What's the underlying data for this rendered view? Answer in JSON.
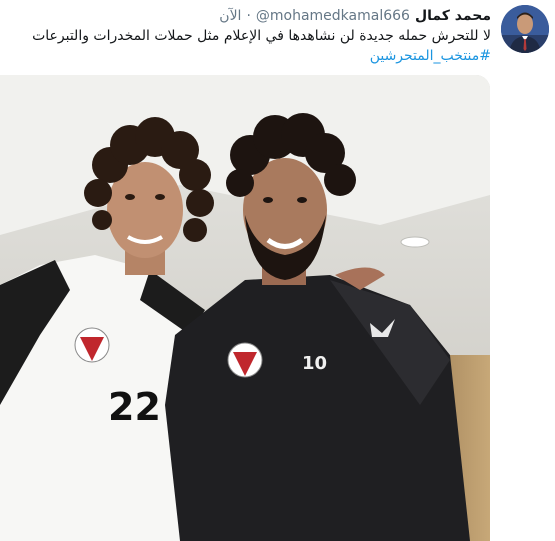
{
  "tweet": {
    "author": {
      "display_name": "محمد كمال",
      "handle": "@mohamedkamal666",
      "avatar_icon": "user-avatar-icon"
    },
    "separator": "·",
    "timestamp": "الآن",
    "text_line_1": "لا للتحرش حمله جديدة لن نشاهدها في الإعلام مثل حملات المخدرات والتبرعات",
    "hashtag": "#منتخب_المتحرشين",
    "media": {
      "kind": "photo",
      "left_jersey_number": "22",
      "right_jersey_number": "10"
    }
  },
  "colors": {
    "text": "#14171a",
    "secondary_text": "#657786",
    "link": "#1b95e0",
    "background": "#ffffff"
  }
}
